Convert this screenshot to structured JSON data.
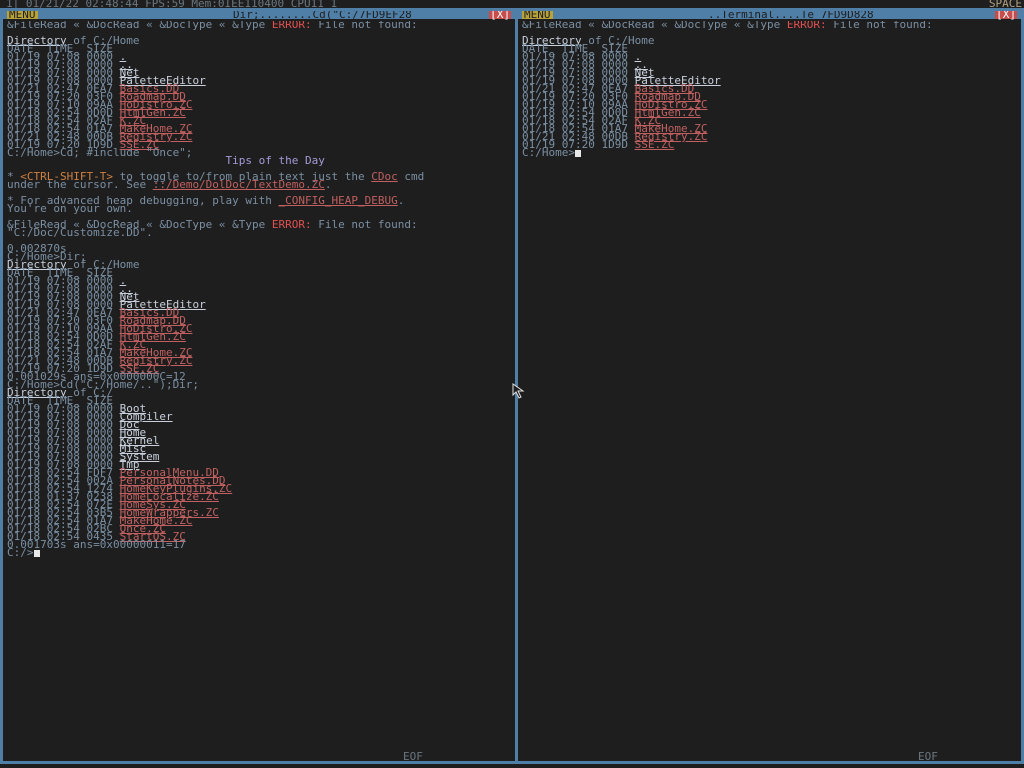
{
  "topbar": {
    "status": "1| 01/21/22 02:48:44 FPS:59 Mem:0IEE110400 CPU11 1",
    "space": "SPACE"
  },
  "left_window": {
    "menu": "MENU",
    "title": "Dir;........Cd(\"C:/7FD9EF28",
    "close": "[X]",
    "eof": "EOF",
    "lines": [
      [
        {
          "t": "&FileRead « &DocRead « &DocType « &Type ",
          "c": "dim"
        },
        {
          "t": "ERROR:",
          "c": "err"
        },
        {
          "t": " File not found:",
          "c": "dim"
        }
      ],
      [
        {
          "t": "",
          "c": "dim"
        }
      ],
      [
        {
          "t": "Directory",
          "c": "ul"
        },
        {
          "t": " of C:/Home",
          "c": "dim"
        }
      ],
      [
        {
          "t": "DATE_ TIME_ SIZE",
          "c": "dim"
        }
      ],
      [
        {
          "t": "01/19 07:08 0000 ",
          "c": "dim"
        },
        {
          "t": ".",
          "c": "ul"
        }
      ],
      [
        {
          "t": "01/19 07:08 0000 ",
          "c": "dim"
        },
        {
          "t": "..",
          "c": "ul"
        }
      ],
      [
        {
          "t": "01/19 07:08 0000 ",
          "c": "dim"
        },
        {
          "t": "Net",
          "c": "ul"
        }
      ],
      [
        {
          "t": "01/19 07:08 0000 ",
          "c": "dim"
        },
        {
          "t": "PaletteEditor",
          "c": "ul"
        }
      ],
      [
        {
          "t": "01/21 02:47 0EA7 ",
          "c": "dim"
        },
        {
          "t": "Basics.DD",
          "c": "link"
        }
      ],
      [
        {
          "t": "01/19 07:20 03F0 ",
          "c": "dim"
        },
        {
          "t": "Roadmap.DD",
          "c": "link"
        }
      ],
      [
        {
          "t": "01/19 07:10 09AA ",
          "c": "dim"
        },
        {
          "t": "HoDistro.ZC",
          "c": "link"
        }
      ],
      [
        {
          "t": "01/18 02:54 0D0D ",
          "c": "dim"
        },
        {
          "t": "HtmlGen.ZC",
          "c": "link"
        }
      ],
      [
        {
          "t": "01/18 02:54 02AF ",
          "c": "dim"
        },
        {
          "t": "K.ZC",
          "c": "link"
        }
      ],
      [
        {
          "t": "01/18 02:54 01A7 ",
          "c": "dim"
        },
        {
          "t": "MakeHome.ZC",
          "c": "link"
        }
      ],
      [
        {
          "t": "01/21 02:48 00DB ",
          "c": "dim"
        },
        {
          "t": "Registry.ZC",
          "c": "link"
        }
      ],
      [
        {
          "t": "01/19 07:20 1D9D ",
          "c": "dim"
        },
        {
          "t": "SSE.ZC",
          "c": "link"
        }
      ],
      [
        {
          "t": "C:/Home>Cd; #include \"Once\";",
          "c": "dim"
        }
      ],
      [
        {
          "t": "                                 Tips of the Day",
          "c": "lav"
        }
      ],
      [
        {
          "t": "",
          "c": "dim"
        }
      ],
      [
        {
          "t": "* ",
          "c": "dim"
        },
        {
          "t": "<CTRL-SHIFT-T>",
          "c": "orange"
        },
        {
          "t": " to toggle to/from plain text just the ",
          "c": "dim"
        },
        {
          "t": "CDoc",
          "c": "link"
        },
        {
          "t": " cmd",
          "c": "dim"
        }
      ],
      [
        {
          "t": "under the cursor. See ",
          "c": "dim"
        },
        {
          "t": "::/Demo/DolDoc/TextDemo.ZC",
          "c": "link"
        },
        {
          "t": ".",
          "c": "dim"
        }
      ],
      [
        {
          "t": "",
          "c": "dim"
        }
      ],
      [
        {
          "t": "* For advanced heap debugging, play with ",
          "c": "dim"
        },
        {
          "t": "_CONFIG_HEAP_DEBUG",
          "c": "link"
        },
        {
          "t": ".",
          "c": "dim"
        }
      ],
      [
        {
          "t": "You're on your own.",
          "c": "dim"
        }
      ],
      [
        {
          "t": "",
          "c": "dim"
        }
      ],
      [
        {
          "t": "&FileRead « &DocRead « &DocType « &Type ",
          "c": "dim"
        },
        {
          "t": "ERROR:",
          "c": "err"
        },
        {
          "t": " File not found:",
          "c": "dim"
        }
      ],
      [
        {
          "t": "\"C:/Doc/Customize.DD\".",
          "c": "dim"
        }
      ],
      [
        {
          "t": "",
          "c": "dim"
        }
      ],
      [
        {
          "t": "0.002870s",
          "c": "dim"
        }
      ],
      [
        {
          "t": "C:/Home>Dir;",
          "c": "dim"
        }
      ],
      [
        {
          "t": "Directory",
          "c": "ul"
        },
        {
          "t": " of C:/Home",
          "c": "dim"
        }
      ],
      [
        {
          "t": "DATE_ TIME_ SIZE",
          "c": "dim"
        }
      ],
      [
        {
          "t": "01/19 07:08 0000 ",
          "c": "dim"
        },
        {
          "t": ".",
          "c": "ul"
        }
      ],
      [
        {
          "t": "01/19 07:08 0000 ",
          "c": "dim"
        },
        {
          "t": "..",
          "c": "ul"
        }
      ],
      [
        {
          "t": "01/19 07:08 0000 ",
          "c": "dim"
        },
        {
          "t": "Net",
          "c": "ul"
        }
      ],
      [
        {
          "t": "01/19 07:08 0000 ",
          "c": "dim"
        },
        {
          "t": "PaletteEditor",
          "c": "ul"
        }
      ],
      [
        {
          "t": "01/21 02:47 0EA7 ",
          "c": "dim"
        },
        {
          "t": "Basics.DD",
          "c": "link"
        }
      ],
      [
        {
          "t": "01/19 07:20 03F0 ",
          "c": "dim"
        },
        {
          "t": "Roadmap.DD",
          "c": "link"
        }
      ],
      [
        {
          "t": "01/19 07:10 09AA ",
          "c": "dim"
        },
        {
          "t": "HoDistro.ZC",
          "c": "link"
        }
      ],
      [
        {
          "t": "01/18 02:54 0D0D ",
          "c": "dim"
        },
        {
          "t": "HtmlGen.ZC",
          "c": "link"
        }
      ],
      [
        {
          "t": "01/18 02:54 02AF ",
          "c": "dim"
        },
        {
          "t": "K.ZC",
          "c": "link"
        }
      ],
      [
        {
          "t": "01/18 02:54 01A7 ",
          "c": "dim"
        },
        {
          "t": "MakeHome.ZC",
          "c": "link"
        }
      ],
      [
        {
          "t": "01/21 02:48 00DB ",
          "c": "dim"
        },
        {
          "t": "Registry.ZC",
          "c": "link"
        }
      ],
      [
        {
          "t": "01/19 07:20 1D9D ",
          "c": "dim"
        },
        {
          "t": "SSE.ZC",
          "c": "link"
        }
      ],
      [
        {
          "t": "0.001029s ans=0x0000000C=12",
          "c": "dim"
        }
      ],
      [
        {
          "t": "C:/Home>Cd(\"C:/Home/..\");Dir;",
          "c": "dim"
        }
      ],
      [
        {
          "t": "Directory",
          "c": "ul"
        },
        {
          "t": " of C:/",
          "c": "dim"
        }
      ],
      [
        {
          "t": "DATE_ TIME_ SIZE",
          "c": "dim"
        }
      ],
      [
        {
          "t": "01/19 07:08 0000 ",
          "c": "dim"
        },
        {
          "t": "Boot",
          "c": "ul"
        }
      ],
      [
        {
          "t": "01/19 07:08 0000 ",
          "c": "dim"
        },
        {
          "t": "Compiler",
          "c": "ul"
        }
      ],
      [
        {
          "t": "01/19 07:08 0000 ",
          "c": "dim"
        },
        {
          "t": "Doc",
          "c": "ul"
        }
      ],
      [
        {
          "t": "01/19 07:08 0000 ",
          "c": "dim"
        },
        {
          "t": "Home",
          "c": "ul"
        }
      ],
      [
        {
          "t": "01/19 07:08 0000 ",
          "c": "dim"
        },
        {
          "t": "Kernel",
          "c": "ul"
        }
      ],
      [
        {
          "t": "01/19 07:08 0000 ",
          "c": "dim"
        },
        {
          "t": "Misc",
          "c": "ul"
        }
      ],
      [
        {
          "t": "01/19 07:08 0000 ",
          "c": "dim"
        },
        {
          "t": "System",
          "c": "ul"
        }
      ],
      [
        {
          "t": "01/19 07:08 0000 ",
          "c": "dim"
        },
        {
          "t": "Tmp",
          "c": "ul"
        }
      ],
      [
        {
          "t": "01/18 02:54 FDF7 ",
          "c": "dim"
        },
        {
          "t": "PersonalMenu.DD",
          "c": "link"
        }
      ],
      [
        {
          "t": "01/18 02:54 002A ",
          "c": "dim"
        },
        {
          "t": "PersonalNotes.DD",
          "c": "link"
        }
      ],
      [
        {
          "t": "01/18 02:54 1274 ",
          "c": "dim"
        },
        {
          "t": "HomeKeyPlugins.ZC",
          "c": "link"
        }
      ],
      [
        {
          "t": "01/18 01:37 0238 ",
          "c": "dim"
        },
        {
          "t": "HomeLocalize.ZC",
          "c": "link"
        }
      ],
      [
        {
          "t": "01/18 02:54 072E ",
          "c": "dim"
        },
        {
          "t": "HomeSys.ZC",
          "c": "link"
        }
      ],
      [
        {
          "t": "01/18 02:54 03B5 ",
          "c": "dim"
        },
        {
          "t": "HomeWrappers.ZC",
          "c": "link"
        }
      ],
      [
        {
          "t": "01/18 02:54 01A7 ",
          "c": "dim"
        },
        {
          "t": "MakeHome.ZC",
          "c": "link"
        }
      ],
      [
        {
          "t": "01/18 02:54 02BC ",
          "c": "dim"
        },
        {
          "t": "Once.ZC",
          "c": "link"
        }
      ],
      [
        {
          "t": "01/18 02:54 0435 ",
          "c": "dim"
        },
        {
          "t": "StartOS.ZC",
          "c": "link"
        }
      ],
      [
        {
          "t": "0.001703s ans=0x00000011=17",
          "c": "dim"
        }
      ],
      [
        {
          "t": "C:/>",
          "c": "dim"
        },
        {
          "t": "__CURSOR__",
          "c": "cursor"
        }
      ]
    ]
  },
  "right_window": {
    "menu": "MENU",
    "title": "..Terminal....Te 7FD9D828",
    "close": "[X]",
    "eof": "EOF",
    "lines": [
      [
        {
          "t": "&FileRead « &DocRead « &DocType « &Type ",
          "c": "dim"
        },
        {
          "t": "ERROR:",
          "c": "err"
        },
        {
          "t": " File not found:",
          "c": "dim"
        }
      ],
      [
        {
          "t": "",
          "c": "dim"
        }
      ],
      [
        {
          "t": "Directory",
          "c": "ul"
        },
        {
          "t": " of C:/Home",
          "c": "dim"
        }
      ],
      [
        {
          "t": "DATE_ TIME_ SIZE",
          "c": "dim"
        }
      ],
      [
        {
          "t": "01/19 07:08 0000 ",
          "c": "dim"
        },
        {
          "t": ".",
          "c": "ul"
        }
      ],
      [
        {
          "t": "01/19 07:08 0000 ",
          "c": "dim"
        },
        {
          "t": "..",
          "c": "ul"
        }
      ],
      [
        {
          "t": "01/19 07:08 0000 ",
          "c": "dim"
        },
        {
          "t": "Net",
          "c": "ul"
        }
      ],
      [
        {
          "t": "01/19 07:08 0000 ",
          "c": "dim"
        },
        {
          "t": "PaletteEditor",
          "c": "ul"
        }
      ],
      [
        {
          "t": "01/21 02:47 0EA7 ",
          "c": "dim"
        },
        {
          "t": "Basics.DD",
          "c": "link"
        }
      ],
      [
        {
          "t": "01/19 07:20 03F0 ",
          "c": "dim"
        },
        {
          "t": "Roadmap.DD",
          "c": "link"
        }
      ],
      [
        {
          "t": "01/19 07:10 09AA ",
          "c": "dim"
        },
        {
          "t": "HoDistro.ZC",
          "c": "link"
        }
      ],
      [
        {
          "t": "01/18 02:54 0D0D ",
          "c": "dim"
        },
        {
          "t": "HtmlGen.ZC",
          "c": "link"
        }
      ],
      [
        {
          "t": "01/18 02:54 02AF ",
          "c": "dim"
        },
        {
          "t": "K.ZC",
          "c": "link"
        }
      ],
      [
        {
          "t": "01/18 02:54 01A7 ",
          "c": "dim"
        },
        {
          "t": "MakeHome.ZC",
          "c": "link"
        }
      ],
      [
        {
          "t": "01/21 02:48 00DB ",
          "c": "dim"
        },
        {
          "t": "Registry.ZC",
          "c": "link"
        }
      ],
      [
        {
          "t": "01/19 07:20 1D9D ",
          "c": "dim"
        },
        {
          "t": "SSE.ZC",
          "c": "link"
        }
      ],
      [
        {
          "t": "C:/Home>",
          "c": "dim"
        },
        {
          "t": "__CURSOR__",
          "c": "cursor"
        }
      ]
    ]
  }
}
